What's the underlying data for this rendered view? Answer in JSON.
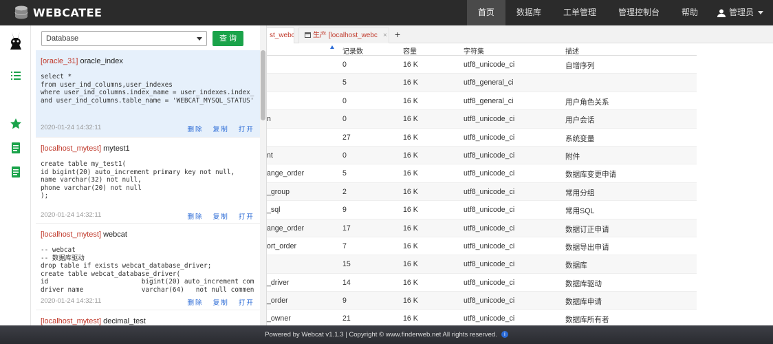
{
  "brand": {
    "name": "WEBCATEE"
  },
  "nav": {
    "items": [
      "首页",
      "数据库",
      "工单管理",
      "管理控制台",
      "帮助"
    ],
    "active": "首页",
    "user": "管理员"
  },
  "sidebar": {
    "icons": [
      "rabbit-logo-icon",
      "list-icon",
      "star-icon",
      "doc-icon",
      "doc2-icon"
    ]
  },
  "search": {
    "select_value": "Database",
    "button": "查 询"
  },
  "cards": [
    {
      "src": "[oracle_31]",
      "name": " oracle_index",
      "code": "select *\nfrom user_ind_columns,user_indexes\nwhere user_ind_columns.index_name = user_indexes.index_\nand user_ind_columns.table_name = 'WEBCAT_MYSQL_STATUS'",
      "time": "2020-01-24 14:32:11",
      "actions": [
        "删除",
        "复制",
        "打开"
      ]
    },
    {
      "src": "[localhost_mytest]",
      "name": " mytest1",
      "code": "create table my_test1(\nid bigint(20) auto_increment primary key not null,\nname varchar(32) not null,\nphone varchar(20) not null\n);",
      "time": "2020-01-24 14:32:11",
      "actions": [
        "删除",
        "复制",
        "打开"
      ]
    },
    {
      "src": "[localhost_mytest]",
      "name": " webcat",
      "code": "-- webcat\n-- 数据库驱动\ndrop table if exists webcat_database_driver;\ncreate table webcat_database_driver(\nid                        bigint(20) auto_increment com\ndriver_name               varchar(64)   not null commen",
      "time": "2020-01-24 14:32:11",
      "actions": [
        "删除",
        "复制",
        "打开"
      ]
    },
    {
      "src": "[localhost_mytest]",
      "name": " decimal_test",
      "code": "",
      "time": "",
      "actions": []
    }
  ],
  "tabs": {
    "first": "st_webc",
    "second": "生产 [localhost_webc",
    "close": "×",
    "add": "+"
  },
  "table": {
    "headers": [
      "记录数",
      "容量",
      "字符集",
      "描述"
    ],
    "rows": [
      {
        "name": "",
        "count": "0",
        "size": "16 K",
        "charset": "utf8_unicode_ci",
        "desc": "自增序列"
      },
      {
        "name": "",
        "count": "5",
        "size": "16 K",
        "charset": "utf8_general_ci",
        "desc": ""
      },
      {
        "name": "",
        "count": "0",
        "size": "16 K",
        "charset": "utf8_general_ci",
        "desc": "用户角色关系"
      },
      {
        "name": "n",
        "count": "0",
        "size": "16 K",
        "charset": "utf8_unicode_ci",
        "desc": "用户会话"
      },
      {
        "name": "",
        "count": "27",
        "size": "16 K",
        "charset": "utf8_unicode_ci",
        "desc": "系统变量"
      },
      {
        "name": "nt",
        "count": "0",
        "size": "16 K",
        "charset": "utf8_unicode_ci",
        "desc": "附件"
      },
      {
        "name": "ange_order",
        "count": "5",
        "size": "16 K",
        "charset": "utf8_unicode_ci",
        "desc": "数据库变更申请"
      },
      {
        "name": "_group",
        "count": "2",
        "size": "16 K",
        "charset": "utf8_unicode_ci",
        "desc": "常用分组"
      },
      {
        "name": "_sql",
        "count": "9",
        "size": "16 K",
        "charset": "utf8_unicode_ci",
        "desc": "常用SQL"
      },
      {
        "name": "ange_order",
        "count": "17",
        "size": "16 K",
        "charset": "utf8_unicode_ci",
        "desc": "数据订正申请"
      },
      {
        "name": "ort_order",
        "count": "7",
        "size": "16 K",
        "charset": "utf8_unicode_ci",
        "desc": "数据导出申请"
      },
      {
        "name": "",
        "count": "15",
        "size": "16 K",
        "charset": "utf8_unicode_ci",
        "desc": "数据库"
      },
      {
        "name": "_driver",
        "count": "14",
        "size": "16 K",
        "charset": "utf8_unicode_ci",
        "desc": "数据库驱动"
      },
      {
        "name": "_order",
        "count": "9",
        "size": "16 K",
        "charset": "utf8_unicode_ci",
        "desc": "数据库申请"
      },
      {
        "name": "_owner",
        "count": "21",
        "size": "16 K",
        "charset": "utf8_unicode_ci",
        "desc": "数据库所有者"
      }
    ]
  },
  "footer": {
    "text": "Powered by Webcat v1.1.3 | Copyright © www.finderweb.net All rights reserved."
  }
}
